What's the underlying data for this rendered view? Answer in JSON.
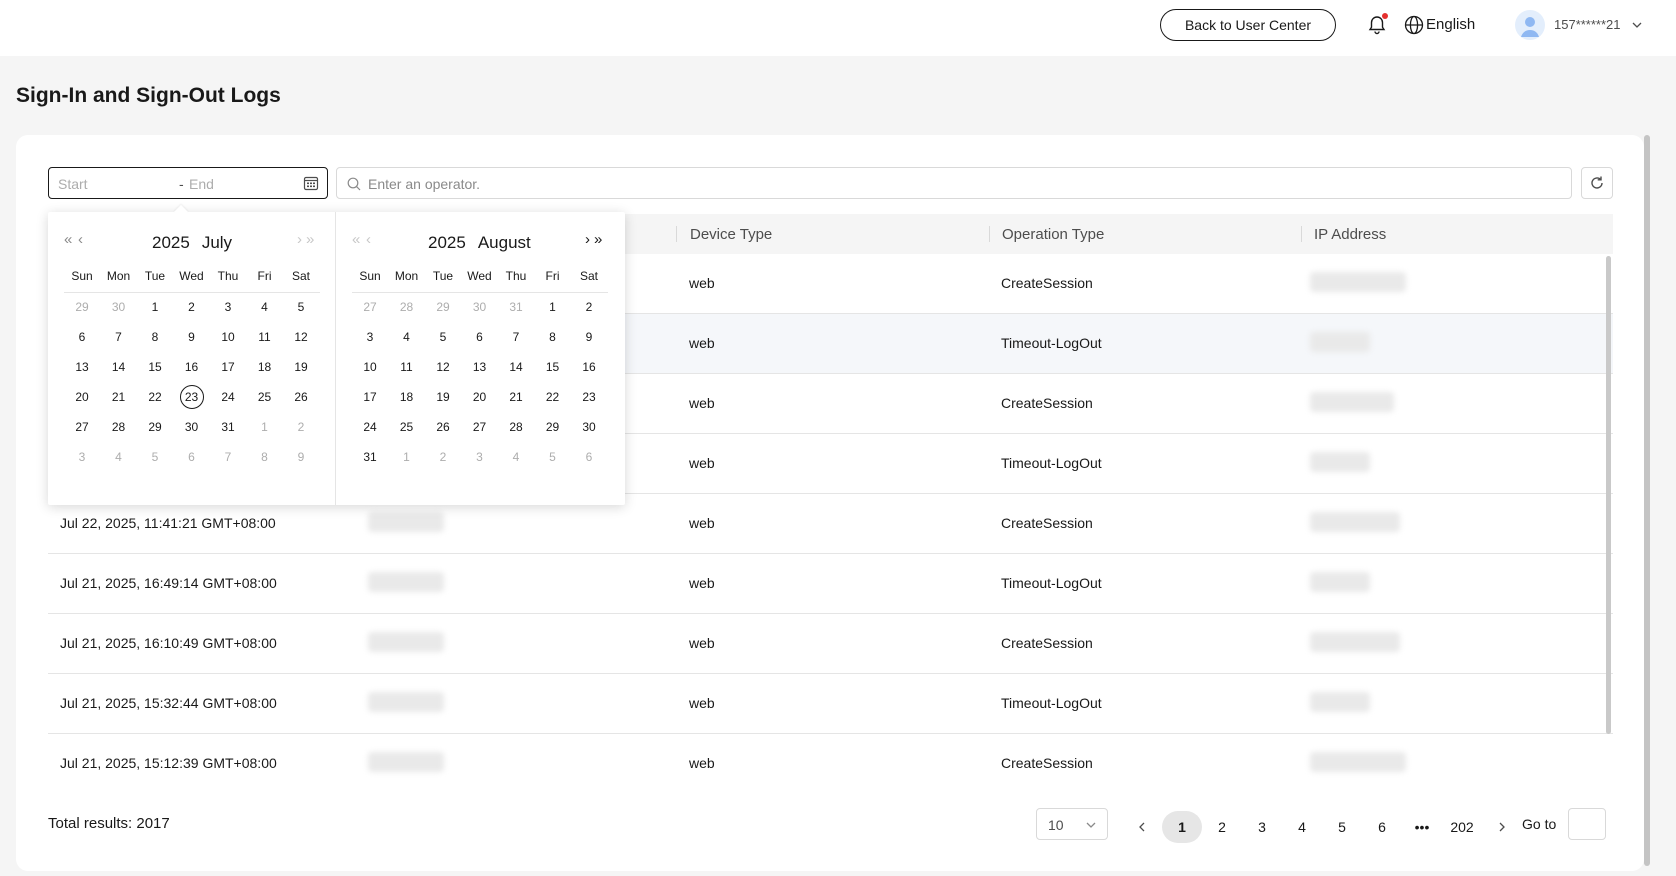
{
  "header": {
    "back_label": "Back to User Center",
    "language": "English",
    "username": "157******21"
  },
  "page": {
    "title": "Sign-In and Sign-Out Logs"
  },
  "filters": {
    "start_placeholder": "Start",
    "separator": "-",
    "end_placeholder": "End",
    "search_placeholder": "Enter an operator."
  },
  "table": {
    "columns": [
      "Device Type",
      "Operation Type",
      "IP Address"
    ],
    "rows": [
      {
        "time": "",
        "device": "web",
        "operation": "CreateSession"
      },
      {
        "time": "",
        "device": "web",
        "operation": "Timeout-LogOut"
      },
      {
        "time": "",
        "device": "web",
        "operation": "CreateSession"
      },
      {
        "time": "",
        "device": "web",
        "operation": "Timeout-LogOut"
      },
      {
        "time": "Jul 22, 2025, 11:41:21 GMT+08:00",
        "device": "web",
        "operation": "CreateSession"
      },
      {
        "time": "Jul 21, 2025, 16:49:14 GMT+08:00",
        "device": "web",
        "operation": "Timeout-LogOut"
      },
      {
        "time": "Jul 21, 2025, 16:10:49 GMT+08:00",
        "device": "web",
        "operation": "CreateSession"
      },
      {
        "time": "Jul 21, 2025, 15:32:44 GMT+08:00",
        "device": "web",
        "operation": "Timeout-LogOut"
      },
      {
        "time": "Jul 21, 2025, 15:12:39 GMT+08:00",
        "device": "web",
        "operation": "CreateSession"
      }
    ]
  },
  "picker": {
    "weekdays": [
      "Sun",
      "Mon",
      "Tue",
      "Wed",
      "Thu",
      "Fri",
      "Sat"
    ],
    "left": {
      "year": "2025",
      "month": "July",
      "days": [
        "29",
        "30",
        "1",
        "2",
        "3",
        "4",
        "5",
        "6",
        "7",
        "8",
        "9",
        "10",
        "11",
        "12",
        "13",
        "14",
        "15",
        "16",
        "17",
        "18",
        "19",
        "20",
        "21",
        "22",
        "23",
        "24",
        "25",
        "26",
        "27",
        "28",
        "29",
        "30",
        "31",
        "1",
        "2",
        "3",
        "4",
        "5",
        "6",
        "7",
        "8",
        "9"
      ],
      "leading_other": 2,
      "current_count": 31,
      "today": "23"
    },
    "right": {
      "year": "2025",
      "month": "August",
      "days": [
        "27",
        "28",
        "29",
        "30",
        "31",
        "1",
        "2",
        "3",
        "4",
        "5",
        "6",
        "7",
        "8",
        "9",
        "10",
        "11",
        "12",
        "13",
        "14",
        "15",
        "16",
        "17",
        "18",
        "19",
        "20",
        "21",
        "22",
        "23",
        "24",
        "25",
        "26",
        "27",
        "28",
        "29",
        "30",
        "31",
        "1",
        "2",
        "3",
        "4",
        "5",
        "6"
      ],
      "leading_other": 5,
      "current_count": 31,
      "today": ""
    }
  },
  "footer": {
    "total": "Total results: 2017",
    "page_size": "10",
    "pages": [
      "1",
      "2",
      "3",
      "4",
      "5",
      "6",
      "•••",
      "202"
    ],
    "active_page": "1",
    "goto_label": "Go to"
  }
}
